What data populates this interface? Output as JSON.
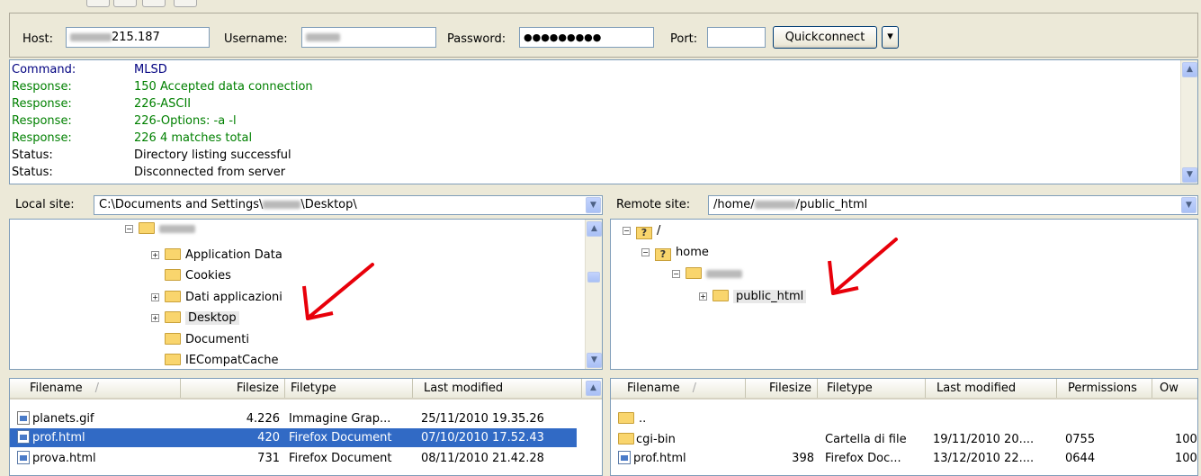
{
  "quickconnect": {
    "host_label": "Host:",
    "host_value_suffix": "215.187",
    "username_label": "Username:",
    "password_label": "Password:",
    "password_value": "●●●●●●●●●",
    "port_label": "Port:",
    "port_value": "",
    "quickconnect_button": "Quickconnect",
    "dropdown_icon": "▾"
  },
  "log": [
    {
      "type": "Command:",
      "message": "MLSD",
      "color": "#000080"
    },
    {
      "type": "Response:",
      "message": "150 Accepted data connection",
      "color": "#008000"
    },
    {
      "type": "Response:",
      "message": "226-ASCII",
      "color": "#008000"
    },
    {
      "type": "Response:",
      "message": "226-Options: -a -l",
      "color": "#008000"
    },
    {
      "type": "Response:",
      "message": "226 4 matches total",
      "color": "#008000"
    },
    {
      "type": "Status:",
      "message": "Directory listing successful",
      "color": "#000000"
    },
    {
      "type": "Status:",
      "message": "Disconnected from server",
      "color": "#000000"
    }
  ],
  "local": {
    "site_label": "Local site:",
    "path_prefix": "C:\\Documents and Settings\\",
    "path_suffix": "\\Desktop\\",
    "tree": [
      "Application Data",
      "Cookies",
      "Dati applicazioni",
      "Desktop",
      "Documenti",
      "IECompatCache"
    ],
    "columns": [
      "Filename",
      "Filesize",
      "Filetype",
      "Last modified"
    ],
    "sort_indicator": "/",
    "files": [
      {
        "name": "planets.gif",
        "size": "4.226",
        "type": "Immagine Grap...",
        "modified": "25/11/2010 19.35.26"
      },
      {
        "name": "prof.html",
        "size": "420",
        "type": "Firefox Document",
        "modified": "07/10/2010 17.52.43"
      },
      {
        "name": "prova.html",
        "size": "731",
        "type": "Firefox Document",
        "modified": "08/11/2010 21.42.28"
      }
    ]
  },
  "remote": {
    "site_label": "Remote site:",
    "path_prefix": "/home/",
    "path_suffix": "/public_html",
    "tree_root": "/",
    "tree_home": "home",
    "tree_public": "public_html",
    "columns": [
      "Filename",
      "Filesize",
      "Filetype",
      "Last modified",
      "Permissions",
      "Ow"
    ],
    "sort_indicator": "/",
    "files": [
      {
        "name": "..",
        "size": "",
        "type": "",
        "modified": "",
        "perms": "",
        "owner": ""
      },
      {
        "name": "cgi-bin",
        "size": "",
        "type": "Cartella di file",
        "modified": "19/11/2010 20....",
        "perms": "0755",
        "owner": "100"
      },
      {
        "name": "prof.html",
        "size": "398",
        "type": "Firefox Doc...",
        "modified": "13/12/2010 22....",
        "perms": "0644",
        "owner": "100"
      }
    ]
  },
  "colors": {
    "selection": "#316ac5",
    "annotation_arrow": "#e8000a"
  }
}
